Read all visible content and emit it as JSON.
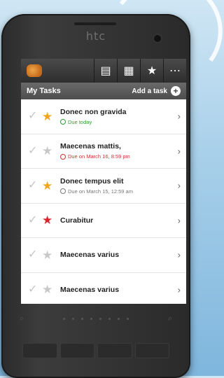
{
  "device": {
    "brand": "htc"
  },
  "actionbar": {
    "app_icon": "app-logo-icon",
    "actions": [
      {
        "icon": "clipboard-icon",
        "glyph": "▤"
      },
      {
        "icon": "note-icon",
        "glyph": "▦"
      },
      {
        "icon": "star-icon",
        "glyph": "★"
      },
      {
        "icon": "overflow-menu-icon",
        "glyph": "⋯"
      }
    ]
  },
  "header": {
    "title": "My Tasks",
    "add_task_label": "Add a task",
    "add_icon_glyph": "+"
  },
  "tasks": [
    {
      "title": "Donec non gravida",
      "star": "gold",
      "due": "Due today",
      "due_color": "#2e9d32"
    },
    {
      "title": "Maecenas mattis,",
      "star": "empty",
      "due": "Due on March 16, 8:59 pm",
      "due_color": "#d32f2f"
    },
    {
      "title": "Donec tempus elit",
      "star": "gold",
      "due": "Due on March 15, 12:59 am",
      "due_color": "#777777"
    },
    {
      "title": "Curabitur",
      "star": "red",
      "due": "",
      "due_color": ""
    },
    {
      "title": "Maecenas varius",
      "star": "empty",
      "due": "",
      "due_color": ""
    },
    {
      "title": "Maecenas varius",
      "star": "empty",
      "due": "",
      "due_color": ""
    }
  ],
  "glyphs": {
    "check": "✓",
    "star": "★",
    "chevron": "›"
  }
}
